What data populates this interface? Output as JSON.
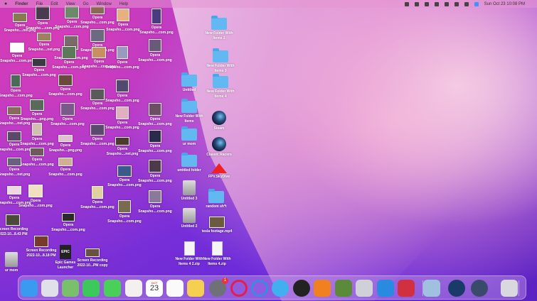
{
  "menubar": {
    "apple": "",
    "items": [
      "Finder",
      "File",
      "Edit",
      "View",
      "Go",
      "Window",
      "Help"
    ],
    "clock": "Sun Oct 23  10:08 PM"
  },
  "desktop": {
    "icons": [
      {
        "kind": "thumb",
        "line1": "Opera",
        "line2": "Snapsho....net.png",
        "color": "#8a7a50"
      },
      {
        "kind": "thumb",
        "line1": "Opera",
        "line2": "Snapsho....com.png",
        "color": "#4a3a50"
      },
      {
        "kind": "thumb",
        "line1": "Opera",
        "line2": "Snapsho....com.png",
        "color": "#6a8a6a"
      },
      {
        "kind": "thumb",
        "line1": "Opera",
        "line2": "Snapsho....com.png",
        "color": "#8a6a50"
      },
      {
        "kind": "thumb",
        "line1": "Opera",
        "line2": "Snapsho....com.png",
        "color": "#e8b080"
      },
      {
        "kind": "thumb",
        "line1": "Opera",
        "line2": "Snapsho....com.png",
        "color": "#4a3a80"
      },
      {
        "kind": "thumb",
        "line1": "Opera",
        "line2": "Snapsho....net.png",
        "color": "#a08060"
      },
      {
        "kind": "thumb",
        "line1": "Opera",
        "line2": "Snapsho....com.png",
        "color": "#7a6a6a"
      },
      {
        "kind": "thumb",
        "line1": "Opera",
        "line2": "Snapsho....com.png",
        "color": "#6a6a80"
      },
      {
        "kind": "thumb",
        "line1": "Opera",
        "line2": "Snapsho....com.png",
        "color": "#ffffff"
      },
      {
        "kind": "thumb",
        "line1": "Opera",
        "line2": "Snapsho....com.png",
        "color": "#3a3a40"
      },
      {
        "kind": "thumb",
        "line1": "Opera",
        "line2": "Snapsho....com.png",
        "color": "#5a7a5a"
      },
      {
        "kind": "thumb",
        "line1": "Opera",
        "line2": "Snapsho....com.png",
        "color": "#c89060"
      },
      {
        "kind": "thumb",
        "line1": "Opera",
        "line2": "Snapsho....com.png",
        "color": "#9a9ac0"
      },
      {
        "kind": "thumb",
        "line1": "Opera",
        "line2": "Snapsho....com.png",
        "color": "#6a5a7a"
      },
      {
        "kind": "thumb",
        "line1": "Opera",
        "line2": "Snapsho....com.png",
        "color": "#4a6a5a"
      },
      {
        "kind": "thumb",
        "line1": "Opera",
        "line2": "Snapsho....com.png",
        "color": "#6a4a3a"
      },
      {
        "kind": "thumb",
        "line1": "Opera",
        "line2": "Snapsho....com.png",
        "color": "#504a70"
      },
      {
        "kind": "thumb",
        "line1": "Opera",
        "line2": "Snapsho....png.png",
        "color": "#5a6a5a"
      },
      {
        "kind": "thumb",
        "line1": "Opera",
        "line2": "Snapsho....net.png",
        "color": "#8a6a5a"
      },
      {
        "kind": "thumb",
        "line1": "Opera",
        "line2": "Snapsho....com.png",
        "color": "#7a5a8a"
      },
      {
        "kind": "thumb",
        "line1": "Opera",
        "line2": "Snapsho....com.png",
        "color": "#5a5a5a"
      },
      {
        "kind": "thumb",
        "line1": "Opera",
        "line2": "Snapsho....com.png",
        "color": "#e0b0c0"
      },
      {
        "kind": "thumb",
        "line1": "Opera",
        "line2": "Snapsho....com.png",
        "color": "#6a5060"
      },
      {
        "kind": "thumb",
        "line1": "Opera",
        "line2": "Snapsho....com.png",
        "color": "#5a4a6a"
      },
      {
        "kind": "thumb",
        "line1": "Opera",
        "line2": "Snapsho....png.png",
        "color": "#e0c0d0"
      },
      {
        "kind": "thumb",
        "line1": "Opera",
        "line2": "Snapsho....com.png",
        "color": "#d0c0b0"
      },
      {
        "kind": "thumb",
        "line1": "Opera",
        "line2": "Snapsho....net.png",
        "color": "#4a3a30"
      },
      {
        "kind": "thumb",
        "line1": "Opera",
        "line2": "Snapsho....com.png",
        "color": "#2a2a4a"
      },
      {
        "kind": "thumb",
        "line1": "Opera",
        "line2": "Snapsho....com.png",
        "color": "#5a4a70"
      },
      {
        "kind": "thumb",
        "line1": "Opera",
        "line2": "Snapsho....com.png",
        "color": "#705a60"
      },
      {
        "kind": "thumb",
        "line1": "Opera",
        "line2": "Snapsho....com.png",
        "color": "#d0b090"
      },
      {
        "kind": "thumb",
        "line1": "Opera",
        "line2": "Snapsho....com.png",
        "color": "#3a5a8a"
      },
      {
        "kind": "thumb",
        "line1": "Opera",
        "line2": "Snapsho....net.png",
        "color": "#6a6080"
      },
      {
        "kind": "thumb",
        "line1": "Opera",
        "line2": "Snapsho....com.png",
        "color": "#4a3a4a"
      },
      {
        "kind": "thumb",
        "line1": "Opera",
        "line2": "Snapsho....com.png",
        "color": "#f0e0c0"
      },
      {
        "kind": "thumb",
        "line1": "Opera",
        "line2": "Snapsho....com.png",
        "color": "#e0d0a0"
      },
      {
        "kind": "thumb",
        "line1": "Opera",
        "line2": "Snapsho....com.png",
        "color": "#f0d8e0"
      },
      {
        "kind": "thumb",
        "line1": "Opera",
        "line2": "Snapsho....com.png",
        "color": "#8a7a9a"
      },
      {
        "kind": "thumb",
        "line1": "Screen Recording",
        "line2": "2022-10...8.43 PM",
        "color": "#4a4a3a"
      },
      {
        "kind": "thumb",
        "line1": "Screen Recording",
        "line2": "2022-10...8.18 PM",
        "color": "#7a3a2a"
      },
      {
        "kind": "epic",
        "line1": "Epic Games",
        "line2": "Launcher",
        "glyph": "EPIC"
      },
      {
        "kind": "thumb",
        "line1": "Screen Recording",
        "line2": "2022-10...PM copy",
        "color": "#6a5040"
      },
      {
        "kind": "drive",
        "line1": "ur mom",
        "line2": ""
      },
      {
        "kind": "thumb",
        "line1": "Opera",
        "line2": "Snapsho....com.png",
        "color": "#7a6a50"
      },
      {
        "kind": "thumb",
        "line1": "Opera",
        "line2": "Snapsho....com.png",
        "color": "#2a2a2a"
      },
      {
        "kind": "folder",
        "line1": "Untitled",
        "line2": ""
      },
      {
        "kind": "folder",
        "line1": "New Folder With",
        "line2": "Items"
      },
      {
        "kind": "folder",
        "line1": "ur mom",
        "line2": ""
      },
      {
        "kind": "folder",
        "line1": "untitled folder",
        "line2": ""
      },
      {
        "kind": "drive",
        "line1": "Untitled 3",
        "line2": ""
      },
      {
        "kind": "drive",
        "line1": "Untitled 2",
        "line2": ""
      },
      {
        "kind": "zip",
        "line1": "New Folder With",
        "line2": "Items 4 2.zip"
      },
      {
        "kind": "folder",
        "line1": "New Folder With",
        "line2": "Items 2"
      },
      {
        "kind": "folder",
        "line1": "New Folder With",
        "line2": "Items 3"
      },
      {
        "kind": "folder",
        "line1": "New Folder With",
        "line2": "Items 4"
      },
      {
        "kind": "steam",
        "line1": "Steam",
        "line2": ""
      },
      {
        "kind": "steam",
        "line1": "Classic Racers",
        "line2": ""
      },
      {
        "kind": "fpv",
        "line1": "FPV.SkyDive",
        "line2": ""
      },
      {
        "kind": "folder",
        "line1": "random sh*t",
        "line2": ""
      },
      {
        "kind": "thumb",
        "line1": "tesla footage.mp4",
        "line2": "",
        "color": "#6a5a40"
      },
      {
        "kind": "zip",
        "line1": "New Folder With",
        "line2": "Items 4.zip"
      }
    ]
  },
  "dock": {
    "items": [
      {
        "icon": "finder-icon",
        "color": "#3a9af0"
      },
      {
        "icon": "launchpad-icon",
        "color": "#e0e0ea"
      },
      {
        "icon": "maps-icon",
        "color": "#7ac06a"
      },
      {
        "icon": "facetime-icon",
        "color": "#3cc85a"
      },
      {
        "icon": "messages-icon",
        "color": "#4ad05a"
      },
      {
        "icon": "photos-icon",
        "color": "#f5f0f0"
      },
      {
        "icon": "calendar-icon",
        "color": "#ffffff"
      },
      {
        "icon": "reminders-icon",
        "color": "#fafafa"
      },
      {
        "icon": "notes-icon",
        "color": "#f5d050"
      },
      {
        "icon": "system-preferences-icon",
        "color": "#707078"
      },
      {
        "icon": "opera-icon",
        "color": "#e0204a"
      },
      {
        "icon": "opera-gx-icon",
        "color": "#3a8ae0"
      },
      {
        "icon": "paint-app-icon",
        "color": "#40b0f0"
      },
      {
        "icon": "alpaca-app-icon",
        "color": "#222222"
      },
      {
        "icon": "blender-icon",
        "color": "#f08020"
      },
      {
        "icon": "minecraft-icon",
        "color": "#5a8a3a"
      },
      {
        "icon": "roblox-icon",
        "color": "#d0d0d8"
      },
      {
        "icon": "roblox-studio-icon",
        "color": "#2a8ae0"
      },
      {
        "icon": "parallels-icon",
        "color": "#d03040"
      },
      {
        "icon": "preview-icon",
        "color": "#a0c0e0"
      },
      {
        "icon": "steam-icon",
        "color": "#1a3a6a"
      },
      {
        "icon": "quicktime-icon",
        "color": "#3a4a6a"
      },
      {
        "icon": "trash-icon",
        "color": "#d8d8de"
      }
    ],
    "calendar": {
      "month": "OCT",
      "day": "23"
    },
    "badge": "1"
  }
}
